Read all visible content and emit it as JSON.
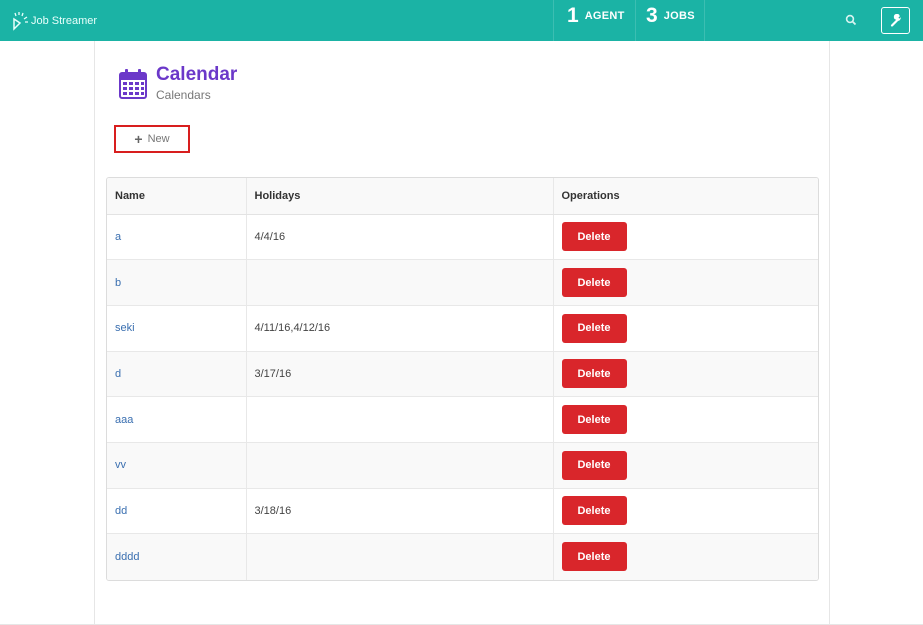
{
  "app": {
    "brand": "Job Streamer",
    "stats": [
      {
        "count": "1",
        "label": "AGENT"
      },
      {
        "count": "3",
        "label": "JOBS"
      }
    ]
  },
  "page": {
    "title": "Calendar",
    "subtitle": "Calendars",
    "new_button": "New"
  },
  "table": {
    "headers": [
      "Name",
      "Holidays",
      "Operations"
    ],
    "rows": [
      {
        "name": "a",
        "holidays": "4/4/16",
        "action": "Delete"
      },
      {
        "name": "b",
        "holidays": "",
        "action": "Delete"
      },
      {
        "name": "seki",
        "holidays": "4/11/16,4/12/16",
        "action": "Delete"
      },
      {
        "name": "d",
        "holidays": "3/17/16",
        "action": "Delete"
      },
      {
        "name": "aaa",
        "holidays": "",
        "action": "Delete"
      },
      {
        "name": "vv",
        "holidays": "",
        "action": "Delete"
      },
      {
        "name": "dd",
        "holidays": "3/18/16",
        "action": "Delete"
      },
      {
        "name": "dddd",
        "holidays": "",
        "action": "Delete"
      }
    ]
  },
  "icons": {
    "brand": "job-streamer-logo-icon",
    "search": "search-icon",
    "tools": "wrench-icon",
    "calendar": "calendar-icon",
    "new": "plus-icon"
  },
  "colors": {
    "topbar": "#1bb3a5",
    "title": "#6b38c9",
    "delete": "#d9262b",
    "link": "#3a6fb0",
    "highlight": "#d81e1e"
  }
}
